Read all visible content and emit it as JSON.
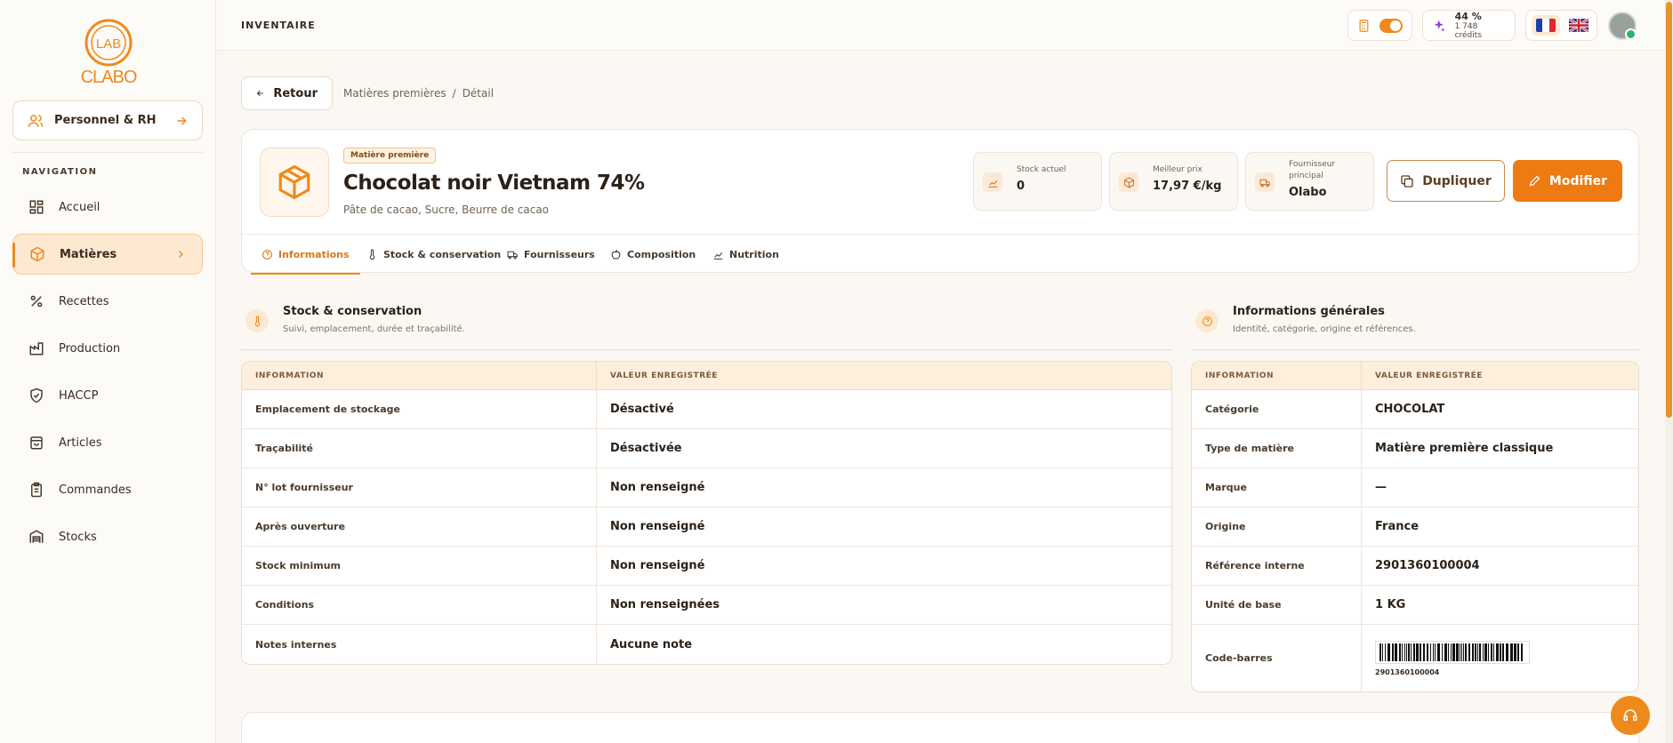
{
  "sidebar": {
    "logo_text": "CLABO",
    "logo_inner": "LAB",
    "personnel_label": "Personnel & RH",
    "nav_title": "NAVIGATION",
    "items": [
      {
        "label": "Accueil",
        "icon": "grid-icon"
      },
      {
        "label": "Matières",
        "icon": "box-icon",
        "active": true
      },
      {
        "label": "Recettes",
        "icon": "percent-icon"
      },
      {
        "label": "Production",
        "icon": "factory-icon"
      },
      {
        "label": "HACCP",
        "icon": "shield-icon"
      },
      {
        "label": "Articles",
        "icon": "bag-icon"
      },
      {
        "label": "Commandes",
        "icon": "clipboard-icon"
      },
      {
        "label": "Stocks",
        "icon": "warehouse-icon"
      }
    ]
  },
  "topbar": {
    "title": "INVENTAIRE",
    "credits_pct": "44 %",
    "credits_sub": "1 748 crédits"
  },
  "breadcrumb": {
    "back_label": "Retour",
    "parent": "Matières premières",
    "sep": "/",
    "current": "Détail"
  },
  "product": {
    "badge": "Matière première",
    "title": "Chocolat noir Vietnam 74%",
    "ingredients": "Pâte de cacao, Sucre, Beurre de cacao",
    "stats": [
      {
        "label": "Stock actuel",
        "value": "0"
      },
      {
        "label": "Meilleur prix",
        "value": "17,97 €/kg"
      },
      {
        "label": "Fournisseur principal",
        "value": "Olabo"
      }
    ],
    "duplicate_label": "Dupliquer",
    "edit_label": "Modifier"
  },
  "tabs": [
    {
      "label": "Informations",
      "active": true
    },
    {
      "label": "Stock & conservation"
    },
    {
      "label": "Fournisseurs"
    },
    {
      "label": "Composition"
    },
    {
      "label": "Nutrition"
    }
  ],
  "stock_section": {
    "title": "Stock & conservation",
    "subtitle": "Suivi, emplacement, durée et traçabilité.",
    "col1": "INFORMATION",
    "col2": "VALEUR ENREGISTRÉE",
    "rows": [
      {
        "k": "Emplacement de stockage",
        "v": "Désactivé"
      },
      {
        "k": "Traçabilité",
        "v": "Désactivée"
      },
      {
        "k": "N° lot fournisseur",
        "v": "Non renseigné"
      },
      {
        "k": "Après ouverture",
        "v": "Non renseigné"
      },
      {
        "k": "Stock minimum",
        "v": "Non renseigné"
      },
      {
        "k": "Conditions",
        "v": "Non renseignées"
      },
      {
        "k": "Notes internes",
        "v": "Aucune note"
      }
    ]
  },
  "general_section": {
    "title": "Informations générales",
    "subtitle": "Identité, catégorie, origine et références.",
    "col1": "INFORMATION",
    "col2": "VALEUR ENREGISTRÉE",
    "rows": [
      {
        "k": "Catégorie",
        "v": "CHOCOLAT"
      },
      {
        "k": "Type de matière",
        "v": "Matière première classique"
      },
      {
        "k": "Marque",
        "v": "—"
      },
      {
        "k": "Origine",
        "v": "France"
      },
      {
        "k": "Référence interne",
        "v": "2901360100004"
      },
      {
        "k": "Unité de base",
        "v": "1 KG"
      }
    ],
    "barcode_label": "Code-barres",
    "barcode_number": "2901360100004"
  },
  "colors": {
    "accent": "#ee8a1b",
    "accent_dark": "#ee7a12"
  }
}
